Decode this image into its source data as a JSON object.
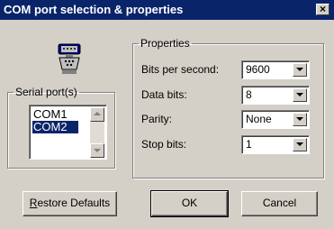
{
  "window": {
    "title": "COM port selection & properties",
    "close_glyph": "×"
  },
  "serial": {
    "legend": "Serial port(s)",
    "icon": "serial-port-icon",
    "ports": [
      "COM1",
      "COM2"
    ],
    "selected": "COM2"
  },
  "properties": {
    "legend": "Properties",
    "fields": [
      {
        "label": "Bits per second:",
        "value": "9600"
      },
      {
        "label": "Data bits:",
        "value": "8"
      },
      {
        "label": "Parity:",
        "value": "None"
      },
      {
        "label": "Stop bits:",
        "value": "1"
      }
    ]
  },
  "buttons": {
    "restore_mnemonic": "R",
    "restore_rest": "estore Defaults",
    "ok": "OK",
    "cancel": "Cancel"
  },
  "colors": {
    "titlebar": "#0a246a",
    "face": "#d4d0c8",
    "selection": "#0a246a"
  }
}
